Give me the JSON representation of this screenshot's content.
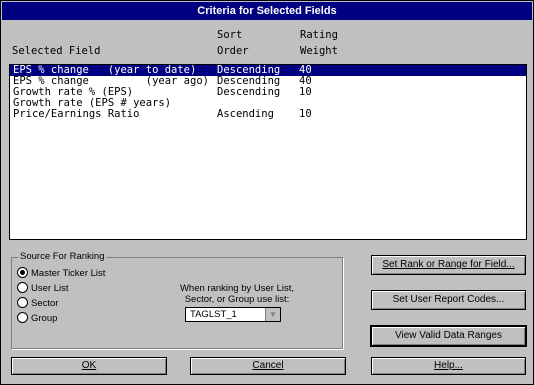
{
  "window": {
    "title": "Criteria for Selected Fields"
  },
  "headers": {
    "field_line1": "",
    "field_line2": "Selected Field",
    "sort_line1": "Sort",
    "sort_line2": "Order",
    "rating_line1": "Rating",
    "rating_line2": "Weight"
  },
  "fields": [
    {
      "field": "EPS % change   (year to date)",
      "sort": "Descending",
      "weight": "40",
      "selected": true
    },
    {
      "field": "EPS % change         (year ago)",
      "sort": "Descending",
      "weight": "40"
    },
    {
      "field": "Growth rate % (EPS)",
      "sort": "Descending",
      "weight": "10"
    },
    {
      "field": "Growth rate (EPS # years)",
      "sort": "",
      "weight": ""
    },
    {
      "field": "Price/Earnings Ratio",
      "sort": "Ascending",
      "weight": "10"
    }
  ],
  "source": {
    "label": "Source For Ranking",
    "options": [
      "Master Ticker List",
      "User List",
      "Sector",
      "Group"
    ],
    "selected": 0,
    "note_line1": "When ranking by User List,",
    "note_line2": "Sector, or Group  use list:",
    "list_value": "TAGLST_1"
  },
  "buttons": {
    "set_rank": "Set Rank or Range for Field...",
    "set_user": "Set User Report Codes...",
    "view_valid": "View Valid Data Ranges",
    "ok": "OK",
    "cancel": "Cancel",
    "help": "Help..."
  }
}
